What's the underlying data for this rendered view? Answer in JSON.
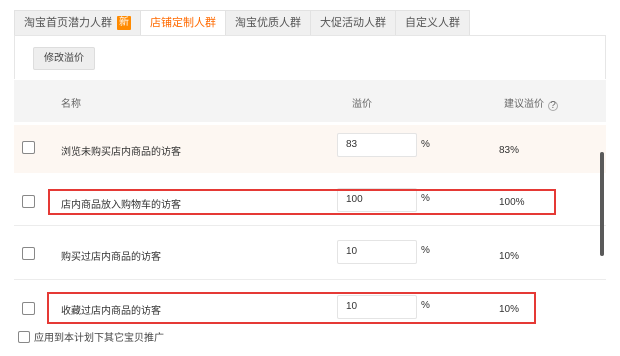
{
  "tabs": [
    {
      "label": "淘宝首页潜力人群",
      "badge": "新",
      "active": false
    },
    {
      "label": "店铺定制人群",
      "active": true
    },
    {
      "label": "淘宝优质人群",
      "active": false
    },
    {
      "label": "大促活动人群",
      "active": false
    },
    {
      "label": "自定义人群",
      "active": false
    }
  ],
  "toolbar": {
    "edit_premium_label": "修改溢价"
  },
  "table": {
    "headers": {
      "name": "名称",
      "premium": "溢价",
      "suggested": "建议溢价"
    },
    "rows": [
      {
        "name": "浏览未购买店内商品的访客",
        "value": "83",
        "unit": "%",
        "suggested": "83%"
      },
      {
        "name": "店内商品放入购物车的访客",
        "value": "100",
        "unit": "%",
        "suggested": "100%"
      },
      {
        "name": "购买过店内商品的访客",
        "value": "10",
        "unit": "%",
        "suggested": "10%"
      },
      {
        "name": "收藏过店内商品的访客",
        "value": "10",
        "unit": "%",
        "suggested": "10%"
      }
    ]
  },
  "footer": {
    "apply_label": "应用到本计划下其它宝贝推广"
  },
  "colors": {
    "accent": "#ff6a00",
    "highlight": "#e53935",
    "badge": "#ff8a00"
  }
}
